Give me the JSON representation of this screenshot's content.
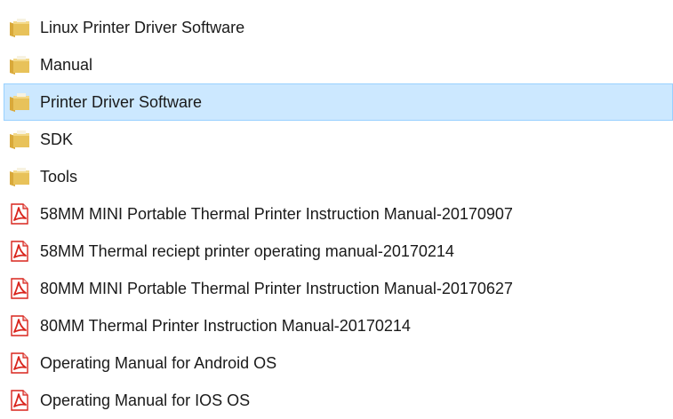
{
  "colors": {
    "selection_bg": "#cce8ff",
    "selection_border": "#99d1ff",
    "folder": "#e8c25a",
    "pdf": "#d9251d"
  },
  "items": [
    {
      "label": "Linux Printer Driver Software",
      "icon": "folder-icon",
      "selected": false
    },
    {
      "label": "Manual",
      "icon": "folder-icon",
      "selected": false
    },
    {
      "label": "Printer Driver Software",
      "icon": "folder-icon",
      "selected": true
    },
    {
      "label": "SDK",
      "icon": "folder-icon",
      "selected": false
    },
    {
      "label": "Tools",
      "icon": "folder-icon",
      "selected": false
    },
    {
      "label": "58MM MINI Portable Thermal Printer Instruction Manual-20170907",
      "icon": "pdf-icon",
      "selected": false
    },
    {
      "label": "58MM Thermal reciept printer operating manual-20170214",
      "icon": "pdf-icon",
      "selected": false
    },
    {
      "label": "80MM MINI Portable Thermal Printer Instruction Manual-20170627",
      "icon": "pdf-icon",
      "selected": false
    },
    {
      "label": "80MM Thermal Printer Instruction Manual-20170214",
      "icon": "pdf-icon",
      "selected": false
    },
    {
      "label": "Operating Manual for Android OS",
      "icon": "pdf-icon",
      "selected": false
    },
    {
      "label": "Operating Manual for IOS OS",
      "icon": "pdf-icon",
      "selected": false
    }
  ]
}
